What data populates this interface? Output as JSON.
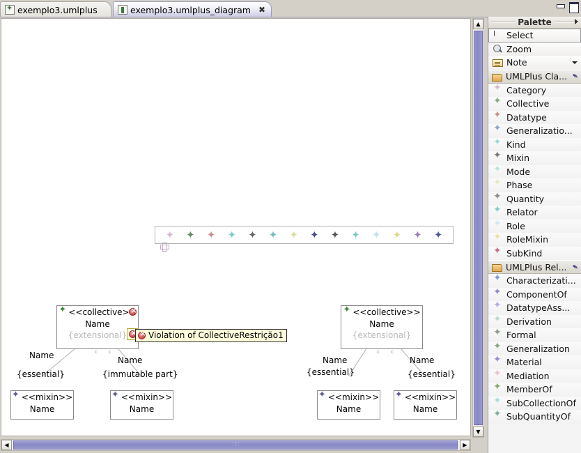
{
  "window": {
    "minimize_label": "Minimize",
    "maximize_label": "Maximize"
  },
  "tabs": [
    {
      "label": "exemplo3.umlplus",
      "icon": "umlplus-model-icon",
      "active": false,
      "closable": false
    },
    {
      "label": "exemplo3.umlplus_diagram",
      "icon": "umlplus-diagram-icon",
      "active": true,
      "closable": true,
      "close_glyph": "✖"
    }
  ],
  "palette": {
    "title": "Palette",
    "collapse_glyph": "▶",
    "tools": [
      {
        "label": "Select",
        "icon": "cursor-icon"
      },
      {
        "label": "Zoom",
        "icon": "magnifier-icon"
      },
      {
        "label": "Note",
        "icon": "note-icon",
        "has_menu": true
      }
    ],
    "drawers": [
      {
        "label": "UMLPlus Cla...",
        "icon": "folder-open-icon",
        "pin_glyph": "✒",
        "items": [
          {
            "label": "Category",
            "color": "#d8b6d0"
          },
          {
            "label": "Collective",
            "color": "#7fae7f"
          },
          {
            "label": "Datatype",
            "color": "#cf8e8e"
          },
          {
            "label": "Generalizatio...",
            "color": "#8fa8c8"
          },
          {
            "label": "Kind",
            "color": "#9ed8d8"
          },
          {
            "label": "Mixin",
            "color": "#777777"
          },
          {
            "label": "Mode",
            "color": "#bfe2e2"
          },
          {
            "label": "Phase",
            "color": "#e8e8c0"
          },
          {
            "label": "Quantity",
            "color": "#8a8a8a"
          },
          {
            "label": "Relator",
            "color": "#88c8c8"
          },
          {
            "label": "Role",
            "color": "#cfe8f2"
          },
          {
            "label": "RoleMixin",
            "color": "#e8e0a8"
          },
          {
            "label": "SubKind",
            "color": "#c8708a"
          }
        ]
      },
      {
        "label": "UMLPlus Rel...",
        "icon": "folder-open-icon",
        "pin_glyph": "✒",
        "items": [
          {
            "label": "Characterizati...",
            "color": "#7f9fd0"
          },
          {
            "label": "ComponentOf",
            "color": "#9090c8"
          },
          {
            "label": "DatatypeAss...",
            "color": "#b0b0e0"
          },
          {
            "label": "Derivation",
            "color": "#b8d8c8"
          },
          {
            "label": "Formal",
            "color": "#8a9a8a"
          },
          {
            "label": "Generalization",
            "color": "#8aa88a"
          },
          {
            "label": "Material",
            "color": "#9a8ad0"
          },
          {
            "label": "Mediation",
            "color": "#e8c0d0"
          },
          {
            "label": "MemberOf",
            "color": "#8aa870"
          },
          {
            "label": "SubCollectionOf",
            "color": "#a8dcdc"
          },
          {
            "label": "SubQuantityOf",
            "color": "#7fae9a"
          }
        ]
      }
    ]
  },
  "canvas": {
    "icon_strip": {
      "name": "umlplus-class-icon-strip",
      "colors": [
        "#d8b6d0",
        "#5f8f5f",
        "#cf8e8e",
        "#7fc8c8",
        "#666666",
        "#6fbcbc",
        "#dcdc9c",
        "#4a4a9c",
        "#555555",
        "#7fc8c8",
        "#bfe0f0",
        "#e0d888",
        "#9a7fb8",
        "#4a5a9c"
      ]
    },
    "classes": [
      {
        "id": "collective-left",
        "stereotype": "<<collective>>",
        "name": "Name",
        "constraint": "{extensional}",
        "icon_color": "#3d8a3d",
        "has_error": true
      },
      {
        "id": "mixin-left-1",
        "stereotype": "<<mixin>>",
        "name": "Name",
        "icon_color": "#5c5c9e",
        "has_error": false
      },
      {
        "id": "mixin-left-2",
        "stereotype": "<<mixin>>",
        "name": "Name",
        "icon_color": "#5c5c9e",
        "has_error": false
      },
      {
        "id": "collective-right",
        "stereotype": "<<collective>>",
        "name": "Name",
        "constraint": "{extensional}",
        "icon_color": "#3d8a3d",
        "has_error": false
      },
      {
        "id": "mixin-right-1",
        "stereotype": "<<mixin>>",
        "name": "Name",
        "icon_color": "#5c5c9e",
        "has_error": false
      },
      {
        "id": "mixin-right-2",
        "stereotype": "<<mixin>>",
        "name": "Name",
        "icon_color": "#5c5c9e",
        "has_error": false
      }
    ],
    "associations": [
      {
        "id": "assoc-left-1",
        "name": "Name",
        "constraint": "{essential}",
        "end_marker": "c"
      },
      {
        "id": "assoc-left-2",
        "name": "Name",
        "constraint": "{immutable part}",
        "end_marker": "c"
      },
      {
        "id": "assoc-right-1",
        "name": "Name",
        "constraint": "{essential}",
        "end_marker": "c"
      },
      {
        "id": "assoc-right-2",
        "name": "Name",
        "constraint": "{essential}",
        "end_marker": "c"
      }
    ],
    "error_tooltip": {
      "text": "Violation of CollectiveRestrição1",
      "icon": "error-icon"
    }
  },
  "scrollbars": {
    "vertical": {
      "up_glyph": "▲",
      "down_glyph": "▼"
    },
    "horizontal": {
      "left_glyph": "◀",
      "right_glyph": "▶",
      "grip": "∷∷"
    }
  }
}
